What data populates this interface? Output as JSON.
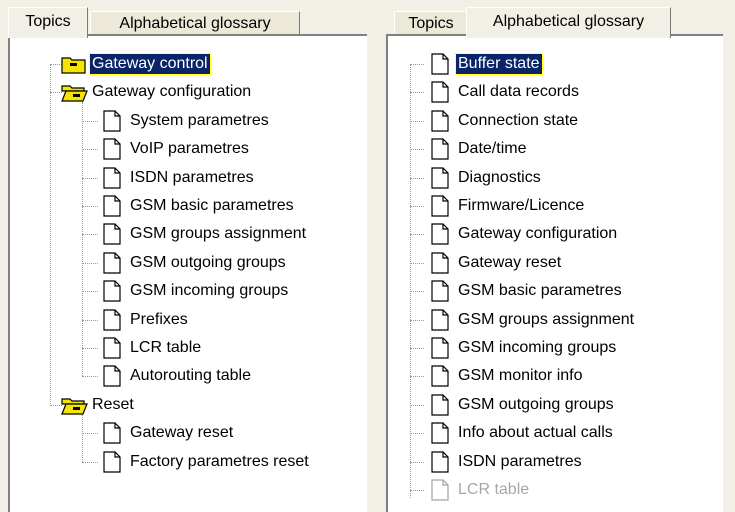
{
  "left_tabs": {
    "topics": "Topics",
    "glossary": "Alphabetical glossary",
    "active": "topics"
  },
  "right_tabs": {
    "topics": "Topics",
    "glossary": "Alphabetical glossary",
    "active": "glossary"
  },
  "topics_tree": [
    {
      "label": "Gateway control",
      "icon": "folder-closed-icon",
      "level": 0,
      "selected": true
    },
    {
      "label": "Gateway configuration",
      "icon": "folder-open-icon",
      "level": 0
    },
    {
      "label": "System parametres",
      "icon": "document-icon",
      "level": 1
    },
    {
      "label": "VoIP parametres",
      "icon": "document-icon",
      "level": 1
    },
    {
      "label": "ISDN parametres",
      "icon": "document-icon",
      "level": 1
    },
    {
      "label": "GSM basic parametres",
      "icon": "document-icon",
      "level": 1
    },
    {
      "label": "GSM groups assignment",
      "icon": "document-icon",
      "level": 1
    },
    {
      "label": "GSM outgoing groups",
      "icon": "document-icon",
      "level": 1
    },
    {
      "label": "GSM incoming groups",
      "icon": "document-icon",
      "level": 1
    },
    {
      "label": "Prefixes",
      "icon": "document-icon",
      "level": 1
    },
    {
      "label": "LCR table",
      "icon": "document-icon",
      "level": 1
    },
    {
      "label": "Autorouting table",
      "icon": "document-icon",
      "level": 1
    },
    {
      "label": "Reset",
      "icon": "folder-open-icon",
      "level": 0
    },
    {
      "label": "Gateway reset",
      "icon": "document-icon",
      "level": 1
    },
    {
      "label": "Factory parametres reset",
      "icon": "document-icon",
      "level": 1
    }
  ],
  "glossary_list": [
    {
      "label": "Buffer state",
      "selected": true
    },
    {
      "label": "Call data records"
    },
    {
      "label": "Connection state"
    },
    {
      "label": "Date/time"
    },
    {
      "label": "Diagnostics"
    },
    {
      "label": "Firmware/Licence"
    },
    {
      "label": "Gateway configuration"
    },
    {
      "label": "Gateway reset"
    },
    {
      "label": "GSM basic parametres"
    },
    {
      "label": "GSM groups assignment"
    },
    {
      "label": "GSM incoming groups"
    },
    {
      "label": "GSM monitor info"
    },
    {
      "label": "GSM outgoing groups"
    },
    {
      "label": "Info about actual calls"
    },
    {
      "label": "ISDN parametres"
    },
    {
      "label": "LCR table",
      "faded": true
    }
  ],
  "colors": {
    "selection": "#0a246a",
    "folder": "#f5e400",
    "background": "#f1efe6"
  }
}
